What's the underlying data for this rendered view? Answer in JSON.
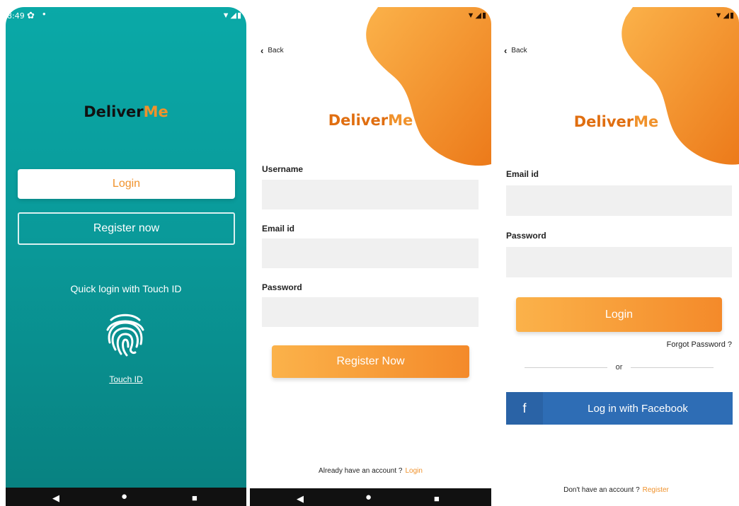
{
  "colors": {
    "teal": "#0aa9a7",
    "orange": "#f0922c",
    "facebook_blue": "#2e6db5"
  },
  "screen1": {
    "status": {
      "time": "8:49",
      "icons": [
        "settings-icon",
        "notification-dot-icon",
        "wifi-icon",
        "signal-icon",
        "battery-icon"
      ]
    },
    "logo": {
      "part1": "Deliver",
      "part2": "Me"
    },
    "login_label": "Login",
    "register_label": "Register now",
    "quick_login_text": "Quick login with Touch ID",
    "touch_id_link": "Touch ID",
    "nav": [
      "back-icon",
      "home-icon",
      "recents-icon"
    ]
  },
  "screen2": {
    "back_label": "Back",
    "logo": {
      "part1": "Deliver",
      "part2": "Me"
    },
    "username_label": "Username",
    "email_label": "Email id",
    "password_label": "Password",
    "register_button": "Register Now",
    "footer_text": "Already have an account ?",
    "footer_link": "Login"
  },
  "screen3": {
    "back_label": "Back",
    "logo": {
      "part1": "Deliver",
      "part2": "Me"
    },
    "email_label": "Email id",
    "password_label": "Password",
    "login_button": "Login",
    "forgot_password": "Forgot Password ?",
    "or_text": "or",
    "facebook_icon_letter": "f",
    "facebook_button": "Log in with Facebook",
    "footer_text": "Don't have an account ?",
    "footer_link": "Register"
  }
}
